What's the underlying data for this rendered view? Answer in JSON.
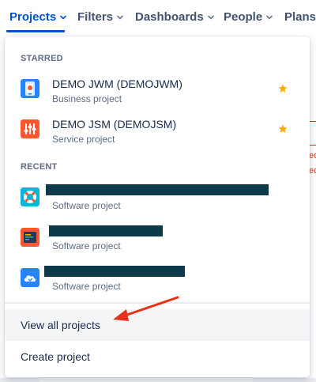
{
  "topnav": {
    "items": [
      {
        "label": "Projects",
        "active": true
      },
      {
        "label": "Filters"
      },
      {
        "label": "Dashboards"
      },
      {
        "label": "People"
      },
      {
        "label": "Plans"
      }
    ]
  },
  "background": {
    "fragments": [
      "ec",
      "ec"
    ]
  },
  "dropdown": {
    "starred_header": "STARRED",
    "recent_header": "RECENT",
    "starred": [
      {
        "name": "DEMO JWM (DEMOJWM)",
        "type": "Business project",
        "icon": "business-project-icon",
        "starred": true
      },
      {
        "name": "DEMO JSM (DEMOJSM)",
        "type": "Service project",
        "icon": "service-project-icon",
        "starred": true
      }
    ],
    "recent": [
      {
        "name_redacted": true,
        "type": "Software project",
        "icon": "lifebuoy-project-icon"
      },
      {
        "name_redacted": true,
        "type": "Software project",
        "icon": "code-editor-project-icon"
      },
      {
        "name_redacted": true,
        "type": "Software project",
        "icon": "cloud-project-icon"
      }
    ],
    "view_all": "View all projects",
    "create": "Create project"
  },
  "colors": {
    "accent": "#0052cc",
    "text": "#172b4d",
    "subtext": "#5e6c84",
    "star": "#ffab00",
    "annotation_arrow": "#e8311a",
    "redaction": "#0d3a4a"
  }
}
